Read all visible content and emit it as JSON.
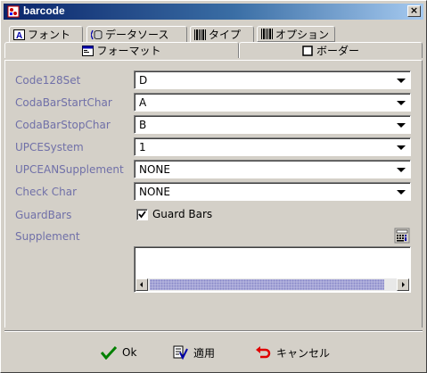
{
  "window": {
    "title": "barcode",
    "close_label": "×"
  },
  "tabs_row1": [
    {
      "label": "フォント",
      "icon": "font-icon"
    },
    {
      "label": "データソース",
      "icon": "datasource-icon"
    },
    {
      "label": "タイプ",
      "icon": "barcode-icon"
    },
    {
      "label": "オプション",
      "icon": "barcode-icon"
    }
  ],
  "tabs_row2": [
    {
      "label": "フォーマット",
      "icon": "format-icon"
    },
    {
      "label": "ボーダー",
      "icon": "border-icon"
    }
  ],
  "fields": [
    {
      "label": "Code128Set",
      "value": "D"
    },
    {
      "label": "CodaBarStartChar",
      "value": "A"
    },
    {
      "label": "CodaBarStopChar",
      "value": "B"
    },
    {
      "label": "UPCESystem",
      "value": "1"
    },
    {
      "label": "UPCEANSupplement",
      "value": "NONE"
    },
    {
      "label": "Check Char",
      "value": "NONE"
    }
  ],
  "guardbars": {
    "label": "GuardBars",
    "checkbox_label": "Guard Bars",
    "checked": true
  },
  "supplement": {
    "label": "Supplement",
    "value": ""
  },
  "buttons": {
    "ok": "Ok",
    "apply": "適用",
    "cancel": "キャンセル"
  },
  "colors": {
    "label": "#7070a8",
    "title_start": "#0a246a",
    "title_end": "#a6caf0",
    "face": "#d4d0c8"
  }
}
